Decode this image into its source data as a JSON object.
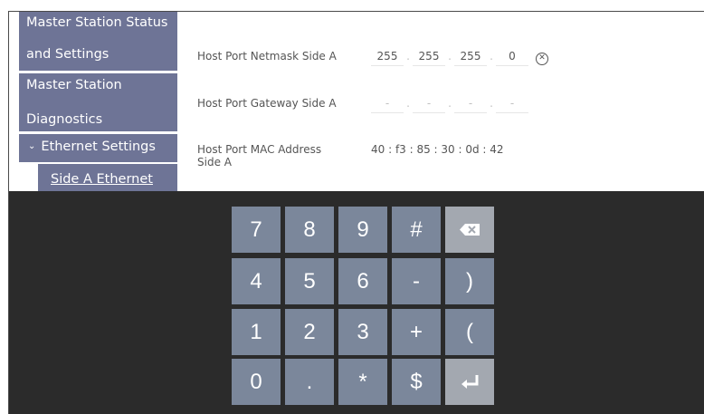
{
  "sidebar": {
    "items": [
      {
        "line1": "Master Station Status",
        "line2": "and Settings"
      },
      {
        "line1": "Master Station",
        "line2": "Diagnostics"
      },
      {
        "label": "Ethernet Settings"
      }
    ],
    "sub_item": "Side A Ethernet"
  },
  "fields": {
    "netmask": {
      "label": "Host Port Netmask Side A",
      "octets": [
        "255",
        "255",
        "255",
        "0"
      ]
    },
    "gateway": {
      "label": "Host Port Gateway Side A",
      "octets": [
        "-",
        "-",
        "-",
        "-"
      ]
    },
    "mac": {
      "label": "Host Port MAC Address Side A",
      "value": "40 : f3 : 85 : 30 : 0d : 42"
    }
  },
  "keypad": {
    "rows": [
      [
        "7",
        "8",
        "9",
        "#",
        "backspace"
      ],
      [
        "4",
        "5",
        "6",
        "-",
        ")"
      ],
      [
        "1",
        "2",
        "3",
        "+",
        "("
      ],
      [
        "0",
        ".",
        "*",
        "$",
        "enter"
      ]
    ],
    "icons": {
      "backspace": "backspace-icon",
      "enter": "enter-icon"
    }
  }
}
